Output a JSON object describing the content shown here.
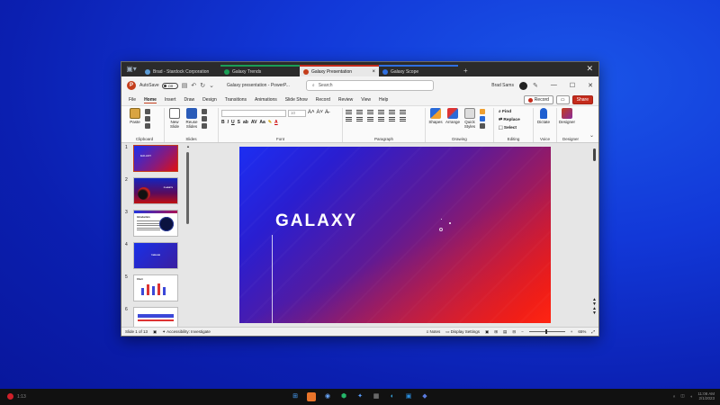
{
  "browser_tabs": [
    {
      "label": "Brad - Stardock Corporation",
      "color": "#5b9bd5",
      "active": false
    },
    {
      "label": "Galaxy Trends",
      "color": "#1a9e55",
      "active": false
    },
    {
      "label": "Galaxy Presentation",
      "color": "#c43e1c",
      "active": true
    },
    {
      "label": "Galaxy Scope",
      "color": "#2f6fe0",
      "active": false
    }
  ],
  "titlebar": {
    "autosave_label": "AutoSave",
    "autosave_state": "Off",
    "document_title": "Galaxy presentation - PowerP...",
    "search_placeholder": "Search",
    "user_name": "Brad Sams"
  },
  "menu": [
    "File",
    "Home",
    "Insert",
    "Draw",
    "Design",
    "Transitions",
    "Animations",
    "Slide Show",
    "Record",
    "Review",
    "View",
    "Help"
  ],
  "menu_active": "Home",
  "menu_buttons": {
    "record": "Record",
    "share": "Share"
  },
  "ribbon": {
    "clipboard": {
      "paste": "Paste",
      "label": "Clipboard"
    },
    "slides": {
      "new_slide": "New Slide",
      "reuse_slides": "Reuse Slides",
      "label": "Slides"
    },
    "font": {
      "label": "Font",
      "size": "10"
    },
    "paragraph": {
      "label": "Paragraph"
    },
    "drawing": {
      "shapes": "Shapes",
      "arrange": "Arrange",
      "quick_styles": "Quick Styles",
      "label": "Drawing"
    },
    "editing": {
      "find": "Find",
      "replace": "Replace",
      "select": "Select",
      "label": "Editing"
    },
    "voice": {
      "dictate": "Dictate",
      "label": "Voice"
    },
    "designer": {
      "designer": "Designer",
      "label": "Designer"
    }
  },
  "thumbnails": [
    {
      "num": "1",
      "text": "GALAXY"
    },
    {
      "num": "2",
      "text": "PLANETS"
    },
    {
      "num": "3",
      "text": "Introduction"
    },
    {
      "num": "4",
      "text": "TIMELINE"
    },
    {
      "num": "5",
      "text": "Chart"
    },
    {
      "num": "6",
      "text": ""
    }
  ],
  "slide": {
    "title": "GALAXY"
  },
  "statusbar": {
    "slide_count": "Slide 1 of 13",
    "accessibility": "Accessibility: Investigate",
    "notes": "Notes",
    "display_settings": "Display Settings",
    "zoom": "65%"
  },
  "taskbar": {
    "recording_time": "1:13",
    "date": "2/1/2023",
    "time": "11:08 AM"
  }
}
